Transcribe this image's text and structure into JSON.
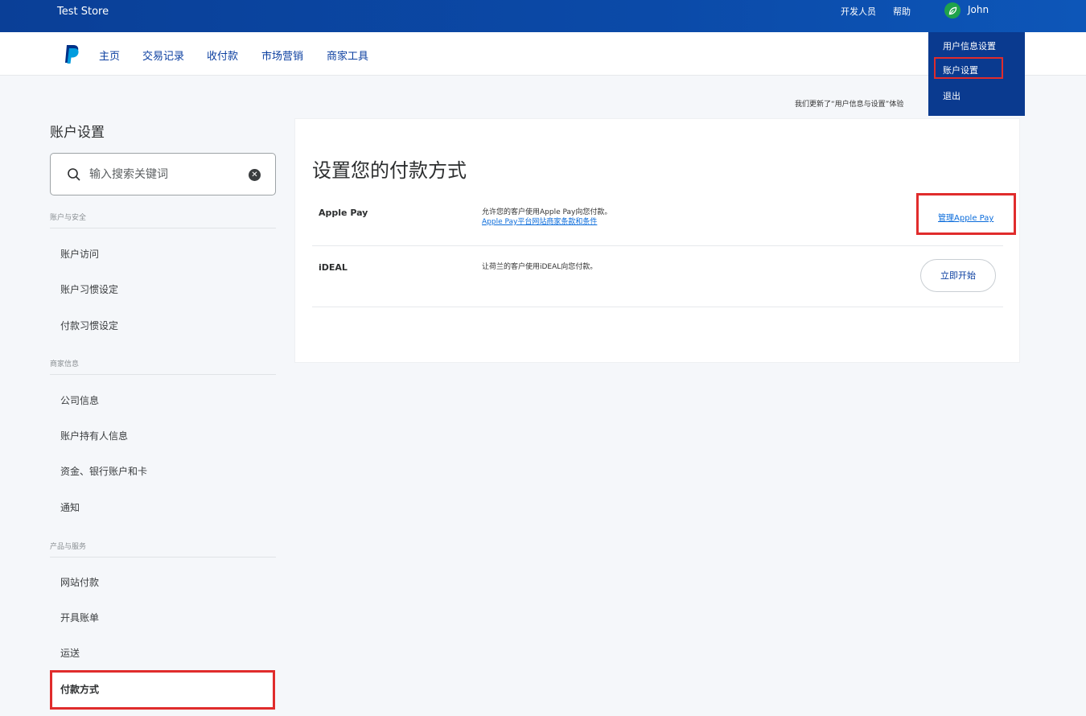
{
  "topbar": {
    "store_name": "Test Store",
    "developer": "开发人员",
    "help": "帮助",
    "user_name": "John"
  },
  "dropdown": {
    "items": [
      "用户信息设置",
      "账户设置",
      "退出"
    ]
  },
  "nav": {
    "items": [
      "主页",
      "交易记录",
      "收付款",
      "市场营销",
      "商家工具"
    ]
  },
  "banner": {
    "text": "我们更新了“用户信息与设置”体验"
  },
  "sidebar": {
    "title": "账户设置",
    "search_placeholder": "输入搜索关键词",
    "sections": [
      {
        "header": "账户与安全",
        "items": [
          "账户访问",
          "账户习惯设定",
          "付款习惯设定"
        ]
      },
      {
        "header": "商家信息",
        "items": [
          "公司信息",
          "账户持有人信息",
          "资金、银行账户和卡",
          "通知"
        ]
      },
      {
        "header": "产品与服务",
        "items": [
          "网站付款",
          "开具账单",
          "运送",
          "付款方式"
        ]
      }
    ]
  },
  "main": {
    "title": "设置您的付款方式",
    "methods": [
      {
        "name": "Apple Pay",
        "description": "允许您的客户使用Apple Pay向您付款。",
        "link": "Apple Pay平台网站商家条款和条件",
        "action": "管理Apple Pay"
      },
      {
        "name": "iDEAL",
        "description": "让荷兰的客户使用iDEAL向您付款。",
        "action": "立即开始"
      }
    ]
  },
  "colors": {
    "topbar": "#0b4aa8",
    "highlight": "#e02c2c",
    "link": "#0b6cdb"
  }
}
